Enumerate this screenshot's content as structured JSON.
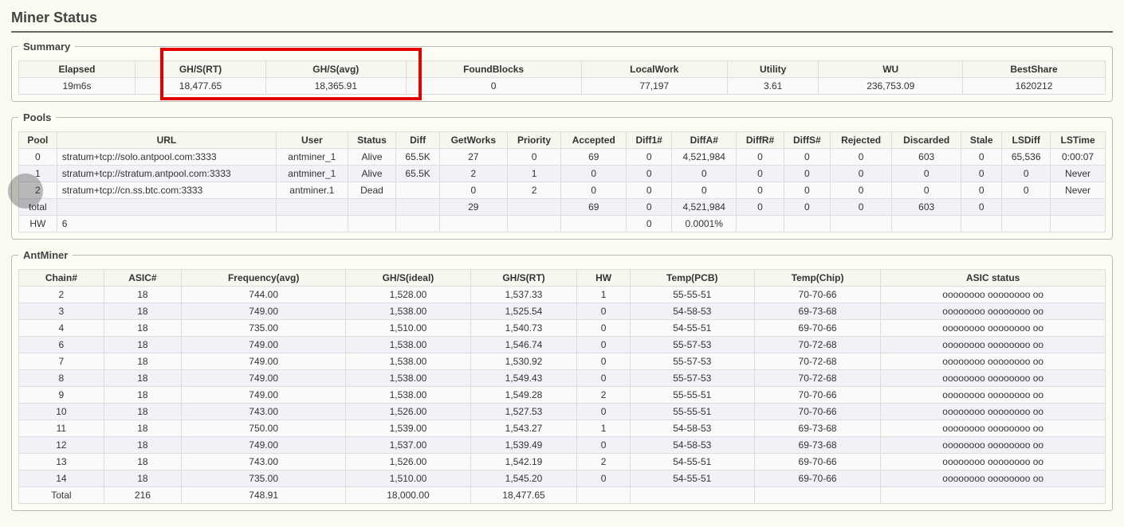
{
  "page_title": "Miner Status",
  "sections": {
    "summary": "Summary",
    "pools": "Pools",
    "antminer": "AntMiner"
  },
  "summary": {
    "headers": [
      "Elapsed",
      "GH/S(RT)",
      "GH/S(avg)",
      "FoundBlocks",
      "LocalWork",
      "Utility",
      "WU",
      "BestShare"
    ],
    "values": [
      "19m6s",
      "18,477.65",
      "18,365.91",
      "0",
      "77,197",
      "3.61",
      "236,753.09",
      "1620212"
    ]
  },
  "pools": {
    "headers": [
      "Pool",
      "URL",
      "User",
      "Status",
      "Diff",
      "GetWorks",
      "Priority",
      "Accepted",
      "Diff1#",
      "DiffA#",
      "DiffR#",
      "DiffS#",
      "Rejected",
      "Discarded",
      "Stale",
      "LSDiff",
      "LSTime"
    ],
    "rows": [
      [
        "0",
        "stratum+tcp://solo.antpool.com:3333",
        "antminer_1",
        "Alive",
        "65.5K",
        "27",
        "0",
        "69",
        "0",
        "4,521,984",
        "0",
        "0",
        "0",
        "603",
        "0",
        "65,536",
        "0:00:07"
      ],
      [
        "1",
        "stratum+tcp://stratum.antpool.com:3333",
        "antminer_1",
        "Alive",
        "65.5K",
        "2",
        "1",
        "0",
        "0",
        "0",
        "0",
        "0",
        "0",
        "0",
        "0",
        "0",
        "Never"
      ],
      [
        "2",
        "stratum+tcp://cn.ss.btc.com:3333",
        "antminer.1",
        "Dead",
        "",
        "0",
        "2",
        "0",
        "0",
        "0",
        "0",
        "0",
        "0",
        "0",
        "0",
        "0",
        "Never"
      ],
      [
        "total",
        "",
        "",
        "",
        "",
        "29",
        "",
        "69",
        "0",
        "4,521,984",
        "0",
        "0",
        "0",
        "603",
        "0",
        "",
        ""
      ],
      [
        "HW",
        "6",
        "",
        "",
        "",
        "",
        "",
        "",
        "0",
        "0.0001%",
        "",
        "",
        "",
        "",
        "",
        "",
        ""
      ]
    ]
  },
  "antminer": {
    "headers": [
      "Chain#",
      "ASIC#",
      "Frequency(avg)",
      "GH/S(ideal)",
      "GH/S(RT)",
      "HW",
      "Temp(PCB)",
      "Temp(Chip)",
      "ASIC status"
    ],
    "rows": [
      [
        "2",
        "18",
        "744.00",
        "1,528.00",
        "1,537.33",
        "1",
        "55-55-51",
        "70-70-66",
        "oooooooo oooooooo oo"
      ],
      [
        "3",
        "18",
        "749.00",
        "1,538.00",
        "1,525.54",
        "0",
        "54-58-53",
        "69-73-68",
        "oooooooo oooooooo oo"
      ],
      [
        "4",
        "18",
        "735.00",
        "1,510.00",
        "1,540.73",
        "0",
        "54-55-51",
        "69-70-66",
        "oooooooo oooooooo oo"
      ],
      [
        "6",
        "18",
        "749.00",
        "1,538.00",
        "1,546.74",
        "0",
        "55-57-53",
        "70-72-68",
        "oooooooo oooooooo oo"
      ],
      [
        "7",
        "18",
        "749.00",
        "1,538.00",
        "1,530.92",
        "0",
        "55-57-53",
        "70-72-68",
        "oooooooo oooooooo oo"
      ],
      [
        "8",
        "18",
        "749.00",
        "1,538.00",
        "1,549.43",
        "0",
        "55-57-53",
        "70-72-68",
        "oooooooo oooooooo oo"
      ],
      [
        "9",
        "18",
        "749.00",
        "1,538.00",
        "1,549.28",
        "2",
        "55-55-51",
        "70-70-66",
        "oooooooo oooooooo oo"
      ],
      [
        "10",
        "18",
        "743.00",
        "1,526.00",
        "1,527.53",
        "0",
        "55-55-51",
        "70-70-66",
        "oooooooo oooooooo oo"
      ],
      [
        "11",
        "18",
        "750.00",
        "1,539.00",
        "1,543.27",
        "1",
        "54-58-53",
        "69-73-68",
        "oooooooo oooooooo oo"
      ],
      [
        "12",
        "18",
        "749.00",
        "1,537.00",
        "1,539.49",
        "0",
        "54-58-53",
        "69-73-68",
        "oooooooo oooooooo oo"
      ],
      [
        "13",
        "18",
        "743.00",
        "1,526.00",
        "1,542.19",
        "2",
        "54-55-51",
        "69-70-66",
        "oooooooo oooooooo oo"
      ],
      [
        "14",
        "18",
        "735.00",
        "1,510.00",
        "1,545.20",
        "0",
        "54-55-51",
        "69-70-66",
        "oooooooo oooooooo oo"
      ],
      [
        "Total",
        "216",
        "748.91",
        "18,000.00",
        "18,477.65",
        "",
        "",
        "",
        ""
      ]
    ]
  }
}
